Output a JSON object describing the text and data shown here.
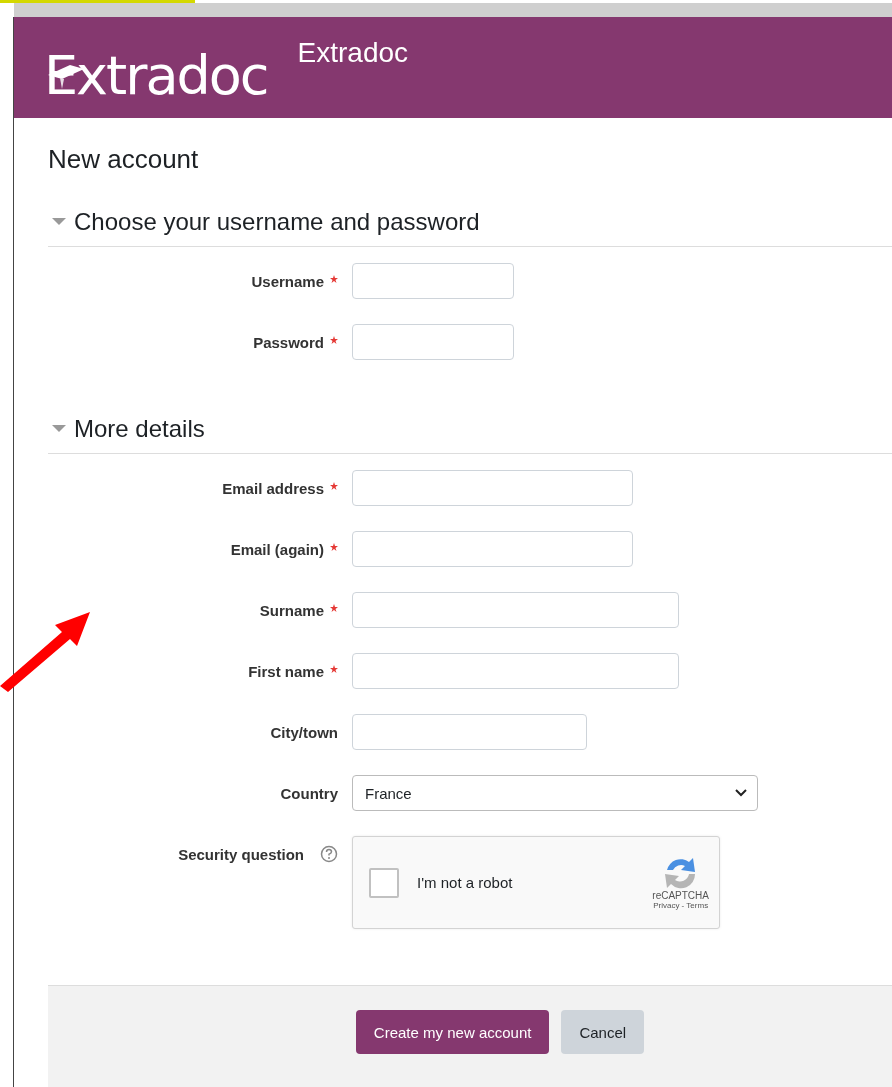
{
  "header": {
    "logo_text": "Extradoc",
    "site_title": "Extradoc"
  },
  "page_title": "New account",
  "sections": [
    {
      "title": "Choose your username and password",
      "expanded": true,
      "fields": [
        {
          "kind": "text",
          "label": "Username",
          "required": true
        },
        {
          "kind": "text",
          "label": "Password",
          "required": true
        }
      ]
    },
    {
      "title": "More details",
      "expanded": true,
      "fields": [
        {
          "kind": "text",
          "label": "Email address",
          "required": true
        },
        {
          "kind": "text",
          "label": "Email (again)",
          "required": true
        },
        {
          "kind": "text",
          "label": "Surname",
          "required": true
        },
        {
          "kind": "text",
          "label": "First name",
          "required": true
        },
        {
          "kind": "text",
          "label": "City/town",
          "required": false
        },
        {
          "kind": "select",
          "label": "Country",
          "required": false,
          "value": "France"
        },
        {
          "kind": "captcha",
          "label": "Security question",
          "required": false,
          "checkbox_label": "I'm not a robot",
          "checked": false,
          "brand": "reCAPTCHA",
          "links": "Privacy - Terms"
        }
      ]
    }
  ],
  "buttons": [
    {
      "label": "Create my new account",
      "kind": "primary"
    },
    {
      "label": "Cancel",
      "kind": "secondary"
    }
  ]
}
